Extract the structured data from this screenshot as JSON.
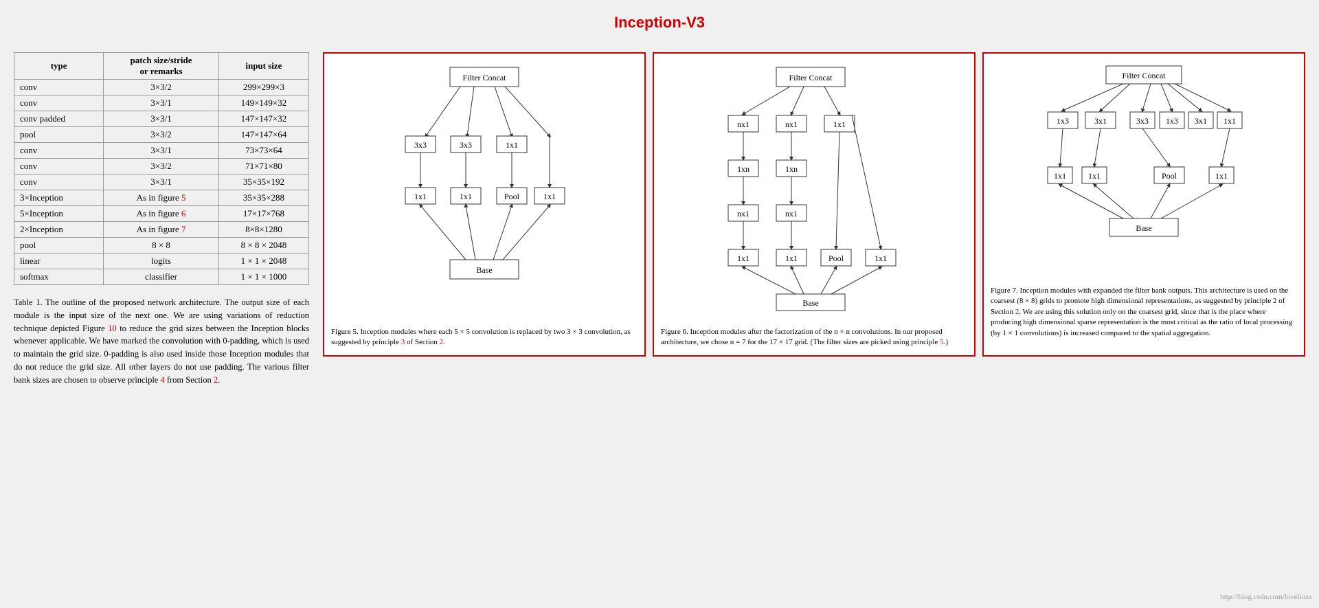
{
  "title": "Inception-V3",
  "table": {
    "headers": [
      "type",
      "patch size/stride or remarks",
      "input size"
    ],
    "rows": [
      {
        "type": "conv",
        "patch": "3×3/2",
        "input": "299×299×3"
      },
      {
        "type": "conv",
        "patch": "3×3/1",
        "input": "149×149×32"
      },
      {
        "type": "conv padded",
        "patch": "3×3/1",
        "input": "147×147×32"
      },
      {
        "type": "pool",
        "patch": "3×3/2",
        "input": "147×147×64"
      },
      {
        "type": "conv",
        "patch": "3×3/1",
        "input": "73×73×64"
      },
      {
        "type": "conv",
        "patch": "3×3/2",
        "input": "71×71×80"
      },
      {
        "type": "conv",
        "patch": "3×3/1",
        "input": "35×35×192"
      },
      {
        "type": "3×Inception",
        "patch": "As in figure 5",
        "input": "35×35×288",
        "ref": "5"
      },
      {
        "type": "5×Inception",
        "patch": "As in figure 6",
        "input": "17×17×768",
        "ref": "6"
      },
      {
        "type": "2×Inception",
        "patch": "As in figure 7",
        "input": "8×8×1280",
        "ref": "7"
      },
      {
        "type": "pool",
        "patch": "8 × 8",
        "input": "8 × 8 × 2048"
      },
      {
        "type": "linear",
        "patch": "logits",
        "input": "1 × 1 × 2048"
      },
      {
        "type": "softmax",
        "patch": "classifier",
        "input": "1 × 1 × 1000"
      }
    ]
  },
  "table_caption": "Table 1. The outline of the proposed network architecture. The output size of each module is the input size of the next one. We are using variations of reduction technique depicted Figure 10 to reduce the grid sizes between the Inception blocks whenever applicable. We have marked the convolution with 0-padding, which is used to maintain the grid size. 0-padding is also used inside those Inception modules that do not reduce the grid size. All other layers do not use padding. The various filter bank sizes are chosen to observe principle 4 from Section 2.",
  "figure5": {
    "caption": "Figure 5. Inception modules where each 5 × 5 convolution is replaced by two 3 × 3 convolution, as suggested by principle 3 of Section 2."
  },
  "figure6": {
    "caption": "Figure 6. Inception modules after the factorization of the n × n convolutions. In our proposed architecture, we chose n = 7 for the 17 × 17 grid. (The filter sizes are picked using principle 5.)"
  },
  "figure7": {
    "caption": "Figure 7. Inception modules with expanded the filter bank outputs. This architecture is used on the coarsest (8 × 8) grids to promote high dimensional representations, as suggested by principle 2 of Section 2. We are using this solution only on the coarsest grid, since that is the place where producing high dimensional sparse representation is the most critical as the ratio of local processing (by 1 × 1 convolutions) is increased compared to the spatial aggregation."
  },
  "watermark": "http://blog.csdn.com/loveliuzz"
}
